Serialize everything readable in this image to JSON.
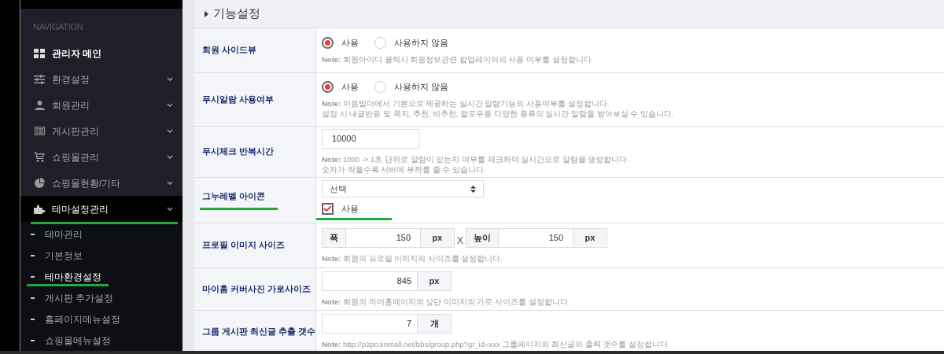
{
  "sidebar": {
    "heading": "NAVIGATION",
    "items": [
      {
        "label": "관리자 메인",
        "bold": true,
        "has_submenu": false,
        "expanded": false,
        "annotated": false
      },
      {
        "label": "환경설정",
        "bold": false,
        "has_submenu": true,
        "expanded": false,
        "annotated": false
      },
      {
        "label": "회원관리",
        "bold": false,
        "has_submenu": true,
        "expanded": false,
        "annotated": false
      },
      {
        "label": "게시판관리",
        "bold": false,
        "has_submenu": true,
        "expanded": false,
        "annotated": false
      },
      {
        "label": "쇼핑몰관리",
        "bold": false,
        "has_submenu": true,
        "expanded": false,
        "annotated": false
      },
      {
        "label": "쇼핑몰현황/기타",
        "bold": false,
        "has_submenu": true,
        "expanded": false,
        "annotated": false
      },
      {
        "label": "테마설정관리",
        "bold": false,
        "has_submenu": true,
        "expanded": true,
        "annotated": true,
        "children": [
          {
            "label": "테마관리",
            "selected": false,
            "annotated": false
          },
          {
            "label": "기본정보",
            "selected": false,
            "annotated": false
          },
          {
            "label": "테마환경설정",
            "selected": true,
            "annotated": true
          },
          {
            "label": "게시판 추가설정",
            "selected": false,
            "annotated": false
          },
          {
            "label": "홈페이지메뉴설정",
            "selected": false,
            "annotated": false
          },
          {
            "label": "쇼핑몰메뉴설정",
            "selected": false,
            "annotated": false
          }
        ]
      }
    ]
  },
  "section_title": "기능설정",
  "rows": [
    {
      "label": "회원 사이드뷰",
      "kind": "radio",
      "annotated": false,
      "options": [
        {
          "label": "사용",
          "selected": true
        },
        {
          "label": "사용하지 않음",
          "selected": false
        }
      ],
      "note": [
        "**Note:** 회원아이디 클릭시 회원정보관련 팝업레이어의 사용 여부를 설정합니다."
      ]
    },
    {
      "label": "푸시알람 사용여부",
      "kind": "radio",
      "annotated": false,
      "options": [
        {
          "label": "사용",
          "selected": true
        },
        {
          "label": "사용하지 않음",
          "selected": false
        }
      ],
      "note": [
        "**Note:** 이윰빌더에서 기본으로 제공하는 실시간 알람기능의 사용여부를 설정합니다.",
        "설정 시 내글반응 및 쪽지, 추천, 비추천, 팔로우등 다양한 종류의 실시간 알람을 받아보실 수 있습니다."
      ]
    },
    {
      "label": "푸시체크 반복시간",
      "kind": "input",
      "annotated": false,
      "value": "10000",
      "note": [
        "**Note:** 1000 -> 1초 단위로 알람이 있는지 여부를 체크하여 실시간으로 알람을 생성합니다.",
        "숫자가 작을수록 서버에 부하를 줄 수 있습니다."
      ]
    },
    {
      "label": "그누레벨 아이콘",
      "kind": "select",
      "annotated": true,
      "select": "선택",
      "checkbox": {
        "label": "사용",
        "checked": true
      }
    },
    {
      "label": "프로필 이미지 사이즈",
      "kind": "size",
      "annotated": false,
      "separator": "X",
      "fields": [
        {
          "prefix": "폭",
          "value": "150",
          "suffix": "px"
        },
        {
          "prefix": "높이",
          "value": "150",
          "suffix": "px"
        }
      ],
      "note": [
        "**Note:** 회원의 프로필 이미지의 사이즈를 설정합니다."
      ]
    },
    {
      "label": "마이홈 커버사진 가로사이즈",
      "kind": "unit",
      "annotated": false,
      "value": "845",
      "suffix": "px",
      "note": [
        "**Note:** 회원의 마이홈페이지의 상단 이미지의 가로 사이즈를 설정합니다."
      ]
    },
    {
      "label": "그룹 게시판 최신글 추출 갯수",
      "kind": "unit",
      "annotated": false,
      "value": "7",
      "suffix": "개",
      "note": [
        "**Note:** http://p2pcoinmall.net/bbs/group.php?gr_id=xxx 그룹페이지의 최신글의 출력 갯수를 설정합니다."
      ]
    }
  ]
}
